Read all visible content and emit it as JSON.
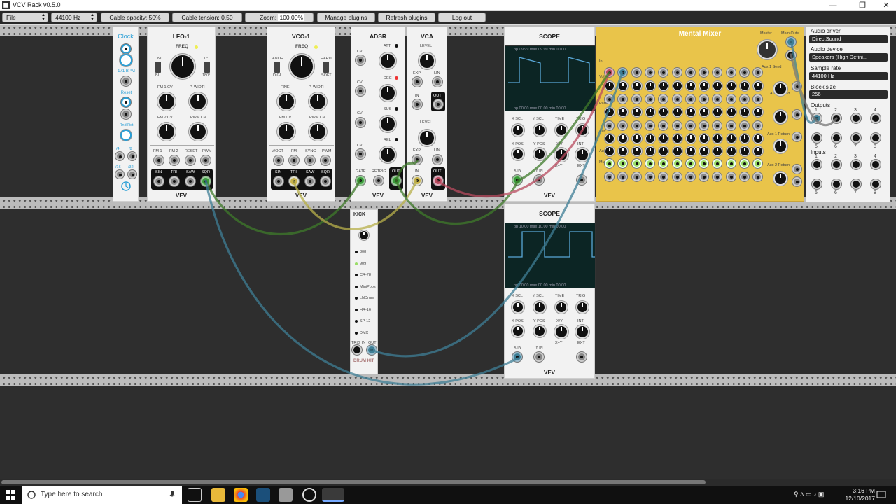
{
  "window": {
    "title": "VCV Rack v0.5.0",
    "controls": [
      "—",
      "❐",
      "✕"
    ]
  },
  "toolbar": {
    "file": "File",
    "sample_rate": "44100 Hz",
    "cable_opacity": "Cable opacity: 50%",
    "cable_tension": "Cable tension: 0.50",
    "zoom_label": "Zoom:",
    "zoom_value": "100.00%",
    "manage_plugins": "Manage plugins",
    "refresh_plugins": "Refresh plugins",
    "log_out": "Log out"
  },
  "modules": {
    "clock": {
      "title": "Clock",
      "bpm": "171 BPM",
      "reset": "Reset",
      "rnd": "Rnd Rst",
      "div1": "/4",
      "div2": "/8",
      "div3": "/16",
      "div4": "/32"
    },
    "lfo": {
      "title": "LFO-1",
      "freq": "FREQ",
      "uni": "UNI",
      "bi": "BI",
      "deg0": "0°",
      "deg180": "180°",
      "fm1cv": "FM 1 CV",
      "pwidth": "P. WIDTH",
      "fm2cv": "FM 2 CV",
      "pwmcv": "PWM CV",
      "in1": "FM 1",
      "in2": "FM 2",
      "in3": "RESET",
      "in4": "PWM",
      "o1": "SIN",
      "o2": "TRI",
      "o3": "SAW",
      "o4": "SQR",
      "brand": "VEV"
    },
    "vco": {
      "title": "VCO-1",
      "freq": "FREQ",
      "anlg": "ANLG",
      "digi": "DIGI",
      "hard": "HARD",
      "soft": "SOFT",
      "fine": "FINE",
      "pwidth": "P. WIDTH",
      "fmcv": "FM CV",
      "pwmcv": "PWM CV",
      "in1": "V/OCT",
      "in2": "FM",
      "in3": "SYNC",
      "in4": "PWM",
      "o1": "SIN",
      "o2": "TRI",
      "o3": "SAW",
      "o4": "SQR",
      "brand": "VEV"
    },
    "adsr": {
      "title": "ADSR",
      "att": "ATT",
      "dec": "DEC",
      "sus": "SUS",
      "rel": "REL",
      "cv": "CV",
      "gate": "GATE",
      "retrig": "RETRIG",
      "out": "OUT",
      "brand": "VEV"
    },
    "vca": {
      "title": "VCA",
      "level": "LEVEL",
      "exp": "EXP",
      "lin": "LIN",
      "in": "IN",
      "out": "OUT",
      "brand": "VEV"
    },
    "scope1": {
      "title": "SCOPE",
      "top": "pp 09.99 max 09.99 min 00.00",
      "bottom": "pp 00.00 max 00.00 min 00.00",
      "xscl": "X SCL",
      "yscl": "Y SCL",
      "time": "TIME",
      "trig": "TRIG",
      "xpos": "X POS",
      "ypos": "Y POS",
      "xy": "X/Y",
      "xplusy": "X+Y",
      "int": "INT",
      "ext": "EXT",
      "xin": "X IN",
      "yin": "Y IN",
      "brand": "VEV"
    },
    "scope2": {
      "title": "SCOPE",
      "top": "pp 10.00 max 10.00 min 00.00",
      "bottom": "pp 00.00 max 00.00 min 00.00",
      "brand": "VEV"
    },
    "kick": {
      "title": "KICK",
      "kits": [
        "808",
        "909",
        "CR-78",
        "MiniPops",
        "LNDrum",
        "HR-16",
        "SP-12",
        "DMX"
      ],
      "trigin": "TRIG IN",
      "out": "OUT",
      "logo": "DRUM KIT"
    },
    "mixer": {
      "title": "Mental Mixer",
      "master": "Master",
      "mainouts": "Main Outs",
      "aux1send": "Aux 1 Send",
      "aux2send": "Aux 2 Send",
      "aux1return": "Aux 1 Return",
      "aux2return": "Aux 2 Return",
      "in": "In",
      "vol": "Vol",
      "pan": "Pan",
      "aux1": "Aux 1",
      "aux2": "Aux 2",
      "mute": "Mute"
    },
    "audio": {
      "driver_label": "Audio driver",
      "driver": "DirectSound",
      "device_label": "Audio device",
      "device": "Speakers (High Defini...",
      "rate_label": "Sample rate",
      "rate": "44100 Hz",
      "block_label": "Block size",
      "block": "256",
      "outputs": "Outputs",
      "inputs": "Inputs",
      "n1": "1",
      "n2": "2",
      "n3": "3",
      "n4": "4",
      "n5": "5",
      "n6": "6",
      "n7": "7",
      "n8": "8"
    }
  },
  "taskbar": {
    "search": "Type here to search",
    "time": "3:16 PM",
    "date": "12/10/2017"
  },
  "colors": {
    "cable_green": "#3f7a2a",
    "cable_yellow": "#b8b04a",
    "cable_red": "#b84a5e",
    "cable_blue": "#3f7f96",
    "mixer_bg": "#e9c44a"
  }
}
